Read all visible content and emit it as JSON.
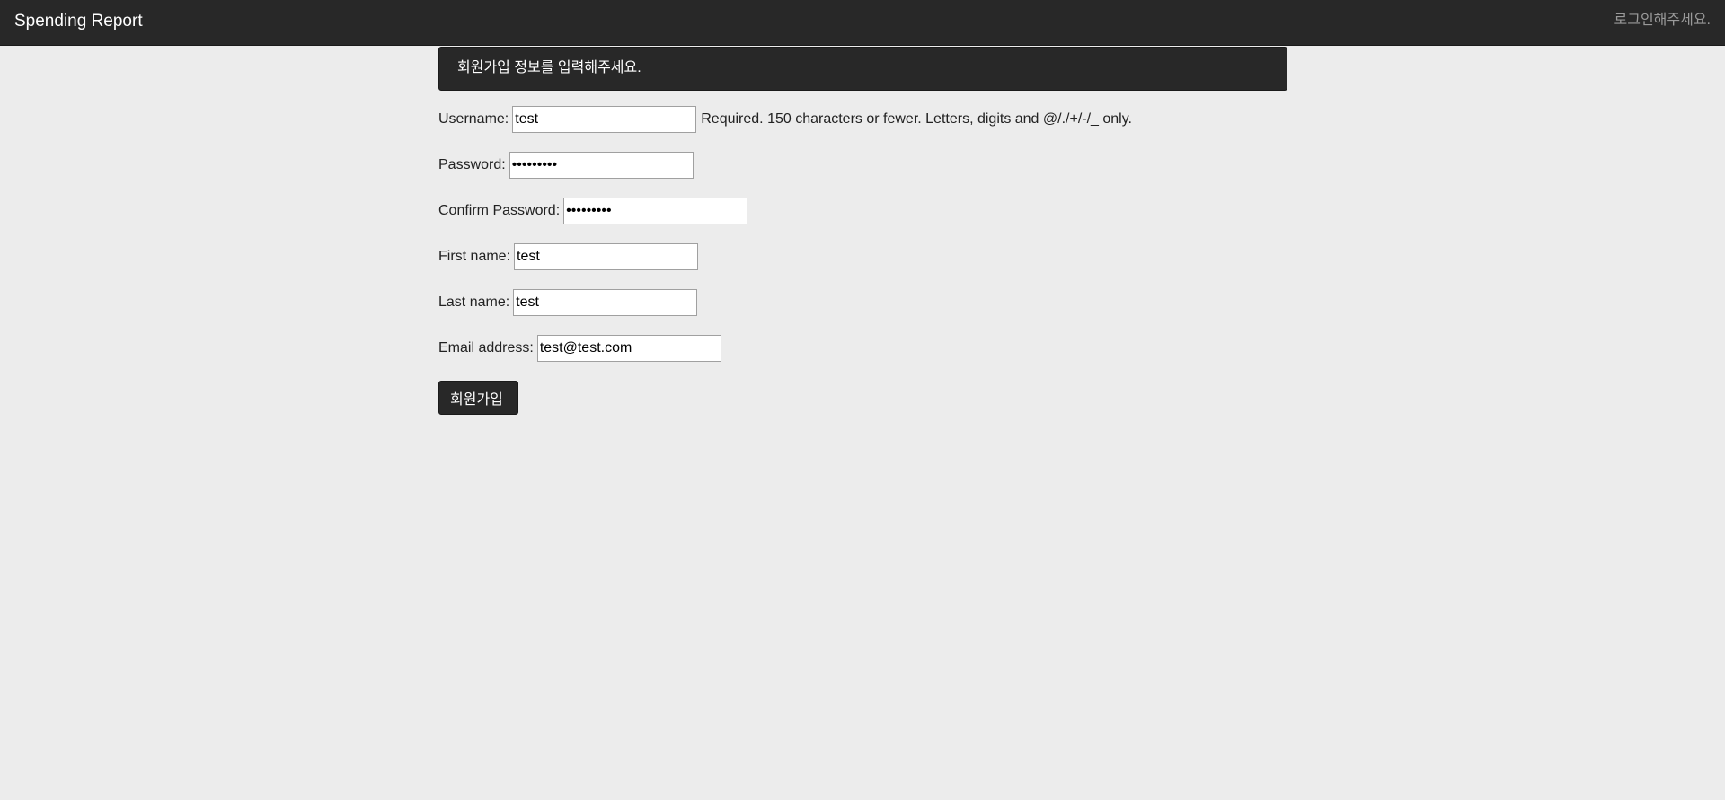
{
  "navbar": {
    "brand": "Spending Report",
    "right_text": "로그인해주세요."
  },
  "alert": {
    "message": "회원가입 정보를 입력해주세요."
  },
  "form": {
    "username": {
      "label": "Username:",
      "value": "test",
      "help": "Required. 150 characters or fewer. Letters, digits and @/./+/-/_ only."
    },
    "password": {
      "label": "Password:",
      "value": "testtest1"
    },
    "confirm_password": {
      "label": "Confirm Password:",
      "value": "testtest1"
    },
    "first_name": {
      "label": "First name:",
      "value": "test"
    },
    "last_name": {
      "label": "Last name:",
      "value": "test"
    },
    "email": {
      "label": "Email address:",
      "value": "test@test.com"
    },
    "submit_label": "회원가입"
  }
}
